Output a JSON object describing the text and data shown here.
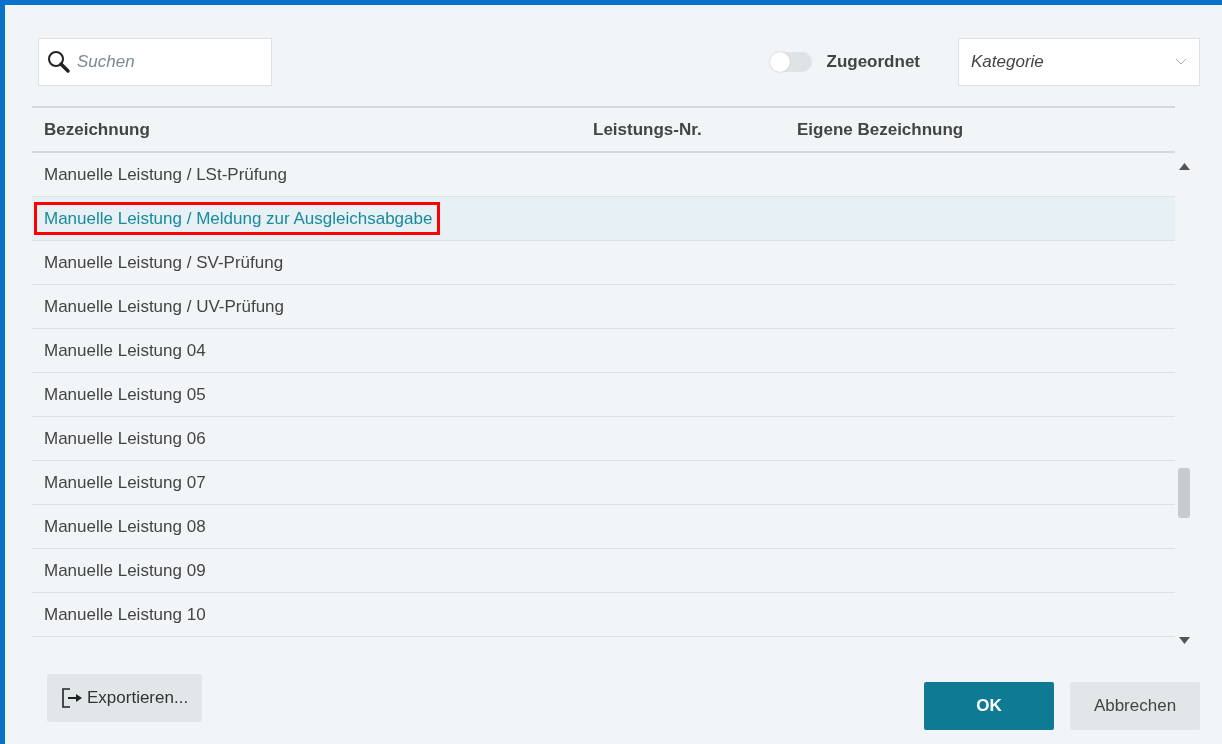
{
  "search": {
    "placeholder": "Suchen"
  },
  "filter_toggle": {
    "label": "Zugeordnet",
    "on": false
  },
  "category_select": {
    "placeholder": "Kategorie"
  },
  "table": {
    "columns": [
      "Bezeichnung",
      "Leistungs-Nr.",
      "Eigene Bezeichnung"
    ],
    "rows": [
      {
        "cells": [
          "Manuelle Leistung / LSt-Prüfung",
          "",
          ""
        ],
        "selected": false,
        "outlined": false
      },
      {
        "cells": [
          "Manuelle Leistung / Meldung zur Ausgleichsabgabe",
          "",
          ""
        ],
        "selected": true,
        "outlined": true
      },
      {
        "cells": [
          "Manuelle Leistung / SV-Prüfung",
          "",
          ""
        ],
        "selected": false,
        "outlined": false
      },
      {
        "cells": [
          "Manuelle Leistung / UV-Prüfung",
          "",
          ""
        ],
        "selected": false,
        "outlined": false
      },
      {
        "cells": [
          "Manuelle Leistung 04",
          "",
          ""
        ],
        "selected": false,
        "outlined": false
      },
      {
        "cells": [
          "Manuelle Leistung 05",
          "",
          ""
        ],
        "selected": false,
        "outlined": false
      },
      {
        "cells": [
          "Manuelle Leistung 06",
          "",
          ""
        ],
        "selected": false,
        "outlined": false
      },
      {
        "cells": [
          "Manuelle Leistung 07",
          "",
          ""
        ],
        "selected": false,
        "outlined": false
      },
      {
        "cells": [
          "Manuelle Leistung 08",
          "",
          ""
        ],
        "selected": false,
        "outlined": false
      },
      {
        "cells": [
          "Manuelle Leistung 09",
          "",
          ""
        ],
        "selected": false,
        "outlined": false
      },
      {
        "cells": [
          "Manuelle Leistung 10",
          "",
          ""
        ],
        "selected": false,
        "outlined": false
      }
    ]
  },
  "buttons": {
    "export": "Exportieren...",
    "ok": "OK",
    "cancel": "Abbrechen"
  }
}
